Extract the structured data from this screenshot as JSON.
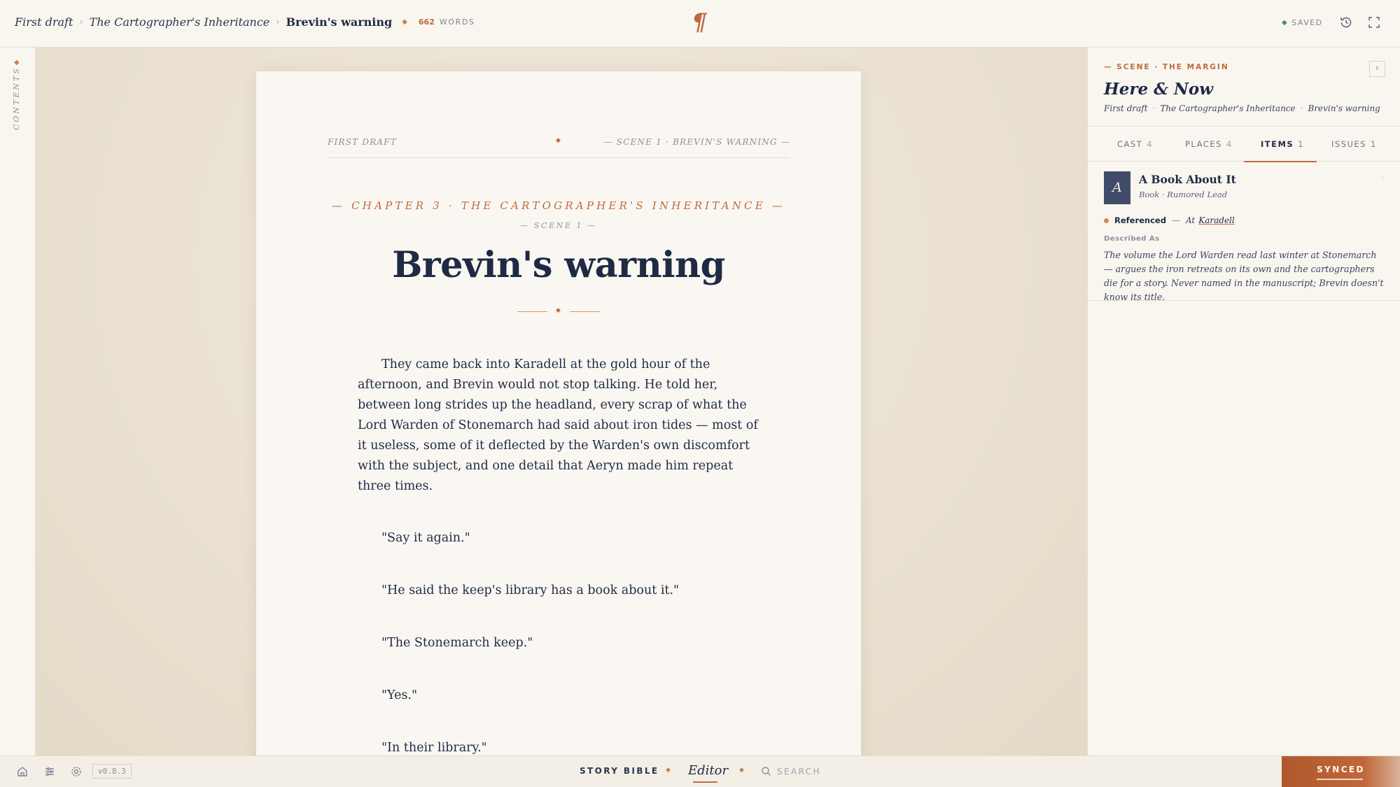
{
  "header": {
    "breadcrumbs": [
      "First draft",
      "The Cartographer's Inheritance",
      "Brevin's warning"
    ],
    "word_count": "662",
    "words_label": "WORDS",
    "logo_glyph": "¶",
    "saved_label": "SAVED"
  },
  "rail": {
    "contents_label": "CONTENTS"
  },
  "manuscript": {
    "running_left": "FIRST DRAFT",
    "running_right": "— SCENE 1 · BREVIN'S WARNING —",
    "chapter_line": "— CHAPTER 3 · THE CARTOGRAPHER'S INHERITANCE —",
    "scene_line": "— SCENE 1 —",
    "title": "Brevin's warning",
    "paragraphs": [
      "They came back into Karadell at the gold hour of the afternoon, and Brevin would not stop talking. He told her, between long strides up the headland, every scrap of what the Lord Warden of Stonemarch had said about iron tides — most of it useless, some of it deflected by the Warden's own discomfort with the subject, and one detail that Aeryn made him repeat three times.",
      "\"Say it again.\"",
      "\"He said the keep's library has a book about it.\"",
      "\"The Stonemarch keep.\"",
      "\"Yes.\"",
      "\"In their library.\""
    ]
  },
  "panel": {
    "eyebrow": "— SCENE · THE MARGIN",
    "title": "Here & Now",
    "crumbs": [
      "First draft",
      "The Cartographer's Inheritance",
      "Brevin's warning"
    ],
    "tabs": [
      {
        "label": "CAST",
        "count": "4"
      },
      {
        "label": "PLACES",
        "count": "4"
      },
      {
        "label": "ITEMS",
        "count": "1"
      },
      {
        "label": "ISSUES",
        "count": "1"
      }
    ],
    "item": {
      "initial": "A",
      "name": "A Book About It",
      "subtitle": "Book · Rumored Lead",
      "status": "Referenced",
      "at_label": "At",
      "place": "Karadell",
      "described_label": "Described As",
      "description": "The volume the Lord Warden read last winter at Stonemarch — argues the iron retreats on its own and the cartographers die for a story. Never named in the manuscript; Brevin doesn't know its title."
    }
  },
  "footer": {
    "version": "v0.8.3",
    "story_bible": "STORY BIBLE",
    "editor": "Editor",
    "search_placeholder": "SEARCH",
    "synced": "SYNCED"
  },
  "colors": {
    "accent": "#c06a3e",
    "ink": "#1f2a44",
    "paper": "#faf7f2",
    "saved_dot": "#4c8a6c"
  }
}
